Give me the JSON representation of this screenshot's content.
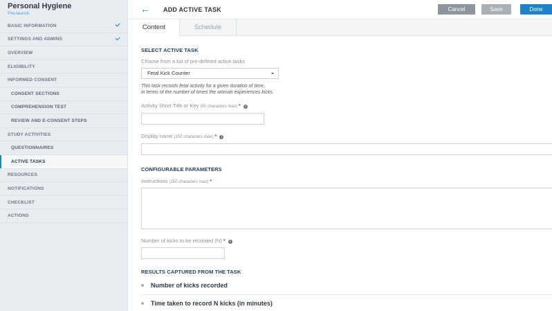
{
  "study": {
    "title": "Personal Hygiene",
    "status": "Pre-launch"
  },
  "sidebar": {
    "items": [
      {
        "label": "BASIC INFORMATION",
        "checked": true
      },
      {
        "label": "SETTINGS AND ADMINS",
        "checked": true
      },
      {
        "label": "OVERVIEW"
      },
      {
        "label": "ELIGIBILITY"
      },
      {
        "label": "INFORMED CONSENT"
      },
      {
        "label": "CONSENT SECTIONS",
        "sub": true
      },
      {
        "label": "COMPREHENSION TEST",
        "sub": true
      },
      {
        "label": "REVIEW AND E-CONSENT STEPS",
        "sub": true
      },
      {
        "label": "STUDY ACTIVITIES"
      },
      {
        "label": "QUESTIONNAIRES",
        "sub": true
      },
      {
        "label": "ACTIVE TASKS",
        "sub": true,
        "active": true
      },
      {
        "label": "RESOURCES"
      },
      {
        "label": "NOTIFICATIONS"
      },
      {
        "label": "CHECKLIST"
      },
      {
        "label": "ACTIONS"
      }
    ]
  },
  "header": {
    "back_icon": "←",
    "title": "ADD ACTIVE TASK",
    "cancel_label": "Cancel",
    "save_label": "Save",
    "done_label": "Done"
  },
  "tabs": {
    "content": "Content",
    "schedule": "Schedule"
  },
  "form": {
    "select_section": "SELECT ACTIVE TASK",
    "select_hint": "Choose from a list of pre-defined active tasks",
    "task_selected": "Fetal Kick Counter",
    "description_line1": "This task records fetal activity for a given duration of time,",
    "description_line2": "in terms of the number of times the woman experiences kicks.",
    "short_title_label": "Activity Short Title or Key",
    "short_title_hint": "(50 characters max)",
    "display_name_label": "Display name",
    "display_name_hint": "(150 characters max)",
    "params_section": "CONFIGURABLE PARAMETERS",
    "instructions_label": "Instructions",
    "instructions_hint": "(150 characters max)",
    "kicks_label": "Number of kicks to be recorded (N)",
    "required_mark": "*",
    "info_glyph": "i",
    "results_section": "RESULTS CAPTURED FROM THE TASK",
    "results": [
      "Number of kicks recorded",
      "Time taken to record N kicks (in minutes)"
    ]
  },
  "colors": {
    "accent": "#1b83c6",
    "sidebar_bg": "#e9edf1",
    "required": "#e1403a"
  }
}
